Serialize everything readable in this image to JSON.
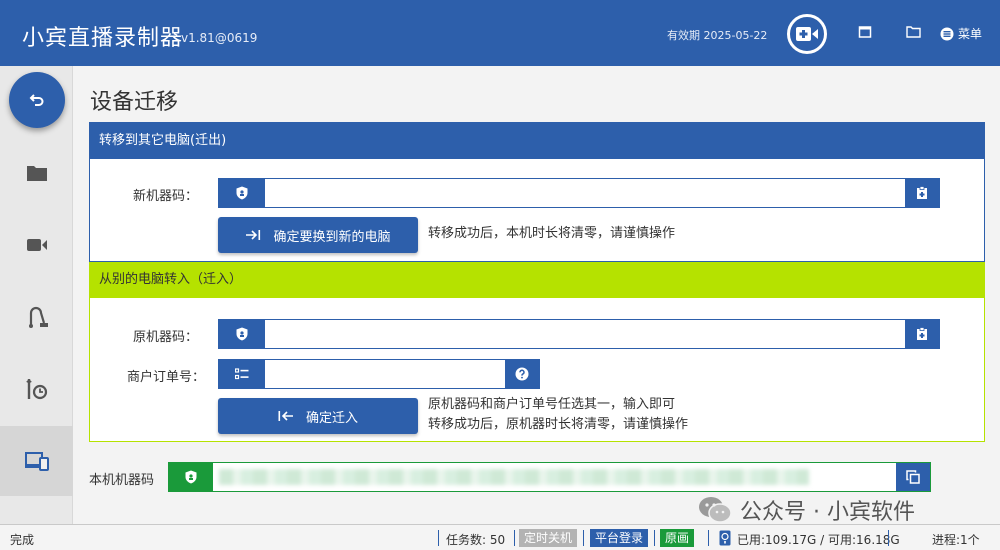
{
  "app": {
    "title": "小宾直播录制器",
    "version": "v1.81@0619",
    "expiry": "有效期 2025-05-22",
    "menu_label": "菜单"
  },
  "sidebar": {
    "items": [
      {
        "icon": "folder-icon"
      },
      {
        "icon": "video-camera-icon"
      },
      {
        "icon": "vacuum-cleaner-icon"
      },
      {
        "icon": "wrench-clock-icon"
      },
      {
        "icon": "devices-icon",
        "active": true
      }
    ]
  },
  "page": {
    "title": "设备迁移"
  },
  "transfer_out": {
    "heading": "转移到其它电脑(迁出)",
    "field_label": "新机器码：",
    "field_value": "",
    "button_label": "确定要换到新的电脑",
    "hint": "转移成功后，本机时长将清零，请谨慎操作"
  },
  "transfer_in": {
    "heading": "从别的电脑转入（迁入）",
    "machine_label": "原机器码：",
    "machine_value": "",
    "order_label": "商户订单号：",
    "order_value": "",
    "button_label": "确定迁入",
    "hint_line1": "原机器码和商户订单号任选其一，输入即可",
    "hint_line2": "转移成功后，原机器时长将清零，请谨慎操作"
  },
  "local": {
    "label": "本机机器码"
  },
  "watermark": {
    "text": "公众号 · 小宾软件"
  },
  "statusbar": {
    "ready": "完成",
    "tasks": "任务数: 50",
    "shutdown_btn": "定时关机",
    "login_btn": "平台登录",
    "original_btn": "原画",
    "disk": "已用:109.17G / 可用:16.18G",
    "progress": "进程:1个"
  },
  "colors": {
    "primary": "#2d5fab",
    "lime": "#b5e200",
    "green": "#1a9a3a",
    "gray_btn": "#b3b3b3"
  }
}
